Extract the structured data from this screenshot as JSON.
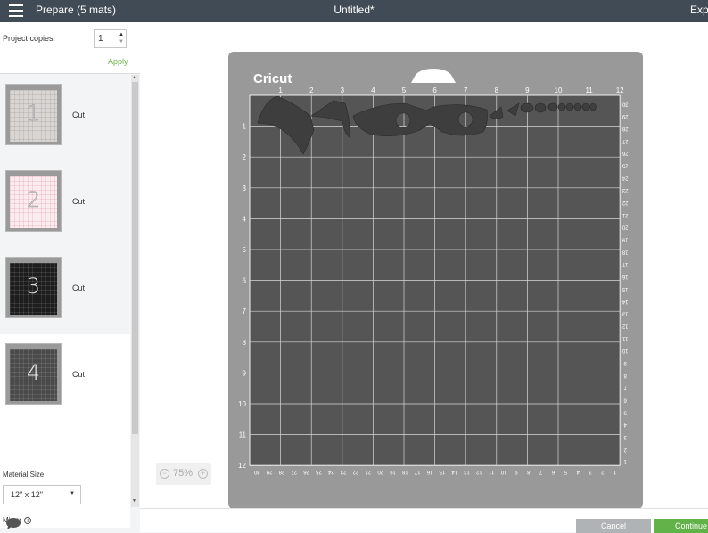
{
  "header": {
    "title": "Prepare (5 mats)",
    "document": "Untitled*",
    "export": "Export"
  },
  "sidebar": {
    "copies_label": "Project copies:",
    "copies_value": "1",
    "apply": "Apply",
    "mats": [
      {
        "number": "1",
        "label": "Cut"
      },
      {
        "number": "2",
        "label": "Cut"
      },
      {
        "number": "3",
        "label": "Cut"
      },
      {
        "number": "4",
        "label": "Cut"
      }
    ],
    "material_size_label": "Material Size",
    "material_size": "12\" x 12\"",
    "mirror_label": "Mirror"
  },
  "mat": {
    "brand": "Cricut",
    "top_ruler": [
      "1",
      "2",
      "3",
      "4",
      "5",
      "6",
      "7",
      "8",
      "9",
      "10",
      "11",
      "12"
    ],
    "left_ruler": [
      "1",
      "2",
      "3",
      "4",
      "5",
      "6",
      "7",
      "8",
      "9",
      "10",
      "11",
      "12"
    ],
    "right_ruler": [
      "30",
      "29",
      "28",
      "27",
      "26",
      "25",
      "24",
      "23",
      "22",
      "21",
      "20",
      "19",
      "18",
      "17",
      "16",
      "15",
      "14",
      "13",
      "12",
      "11",
      "10",
      "9",
      "8",
      "7",
      "6",
      "5",
      "4",
      "3",
      "2",
      "1"
    ],
    "bottom_ruler": [
      "30",
      "29",
      "28",
      "27",
      "26",
      "25",
      "24",
      "23",
      "22",
      "21",
      "20",
      "19",
      "18",
      "17",
      "16",
      "15",
      "14",
      "13",
      "12",
      "11",
      "10",
      "9",
      "8",
      "7",
      "6",
      "5",
      "4",
      "3",
      "2",
      "1"
    ],
    "zoom": "75%"
  },
  "footer": {
    "cancel": "Cancel",
    "continue": "Continue"
  },
  "colors": {
    "header_bg": "#414b55",
    "accent_green": "#6bb34a",
    "mat_grid": "#555555",
    "cut_shapes": "#3e3e3e"
  }
}
